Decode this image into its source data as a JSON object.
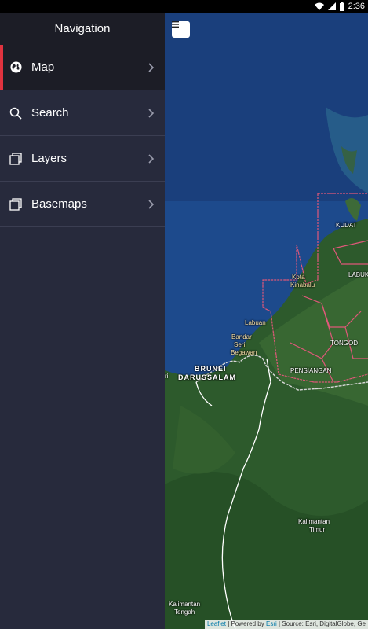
{
  "status_bar": {
    "time": "2:36"
  },
  "sidebar": {
    "title": "Navigation",
    "items": [
      {
        "label": "Map",
        "icon": "globe-icon",
        "active": true
      },
      {
        "label": "Search",
        "icon": "search-icon",
        "active": false
      },
      {
        "label": "Layers",
        "icon": "layers-icon",
        "active": false
      },
      {
        "label": "Basemaps",
        "icon": "basemaps-icon",
        "active": false
      }
    ]
  },
  "map": {
    "menu_button": "≡",
    "labels": {
      "kudat": "KUDAT",
      "labuk": "LABUK",
      "kota_kinabalu_1": "Kota",
      "kota_kinabalu_2": "Kinabalu",
      "labuan": "Labuan",
      "bandar_1": "Bandar",
      "bandar_2": "Seri",
      "bandar_3": "Begawan",
      "brunei_1": "BRUNEI",
      "brunei_2": "DARUSSALAM",
      "tongod": "TONGOD",
      "pensiangan": "PENSIANGAN",
      "kaltim_1": "Kalimantan",
      "kaltim_2": "Timur",
      "kalteng_1": "Kalimantan",
      "kalteng_2": "Tengah",
      "edge_ri": "ri"
    },
    "attribution": {
      "leaflet": "Leaflet",
      "powered": " | Powered by ",
      "esri": "Esri",
      "source": " | Source: Esri, DigitalGlobe, Ge"
    }
  },
  "colors": {
    "accent": "#e0333f",
    "sidebar_bg": "#272a3c",
    "header_bg": "#1c1d26"
  }
}
